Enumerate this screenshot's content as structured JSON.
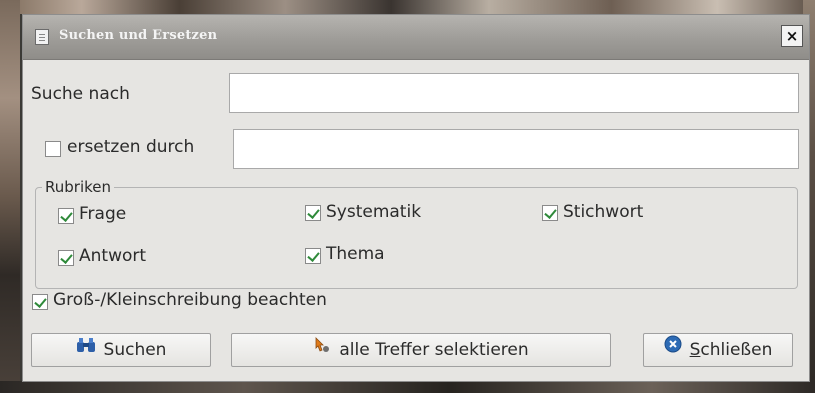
{
  "window": {
    "title": "Suchen und Ersetzen",
    "close_label": "×"
  },
  "search": {
    "label": "Suche nach",
    "value": ""
  },
  "replace": {
    "label": "ersetzen durch",
    "checked": false,
    "value": ""
  },
  "rubriken": {
    "title": "Rubriken",
    "items": [
      {
        "label": "Frage",
        "checked": true
      },
      {
        "label": "Systematik",
        "checked": true
      },
      {
        "label": "Stichwort",
        "checked": true
      },
      {
        "label": "Antwort",
        "checked": true
      },
      {
        "label": "Thema",
        "checked": true
      }
    ]
  },
  "case_sensitive": {
    "label": "Groß-/Kleinschreibung beachten",
    "checked": true
  },
  "buttons": {
    "search": {
      "label": "Suchen",
      "icon": "binoculars-icon"
    },
    "select_all": {
      "label": "alle Treffer selektieren",
      "icon": "cursor-arrow-icon"
    },
    "close": {
      "label_first": "S",
      "label_rest": "chließen",
      "icon": "close-circle-icon"
    }
  },
  "colors": {
    "check": "#2f8a3a",
    "close_icon": "#2d6bb5",
    "titlebar": "#9e9c98"
  }
}
